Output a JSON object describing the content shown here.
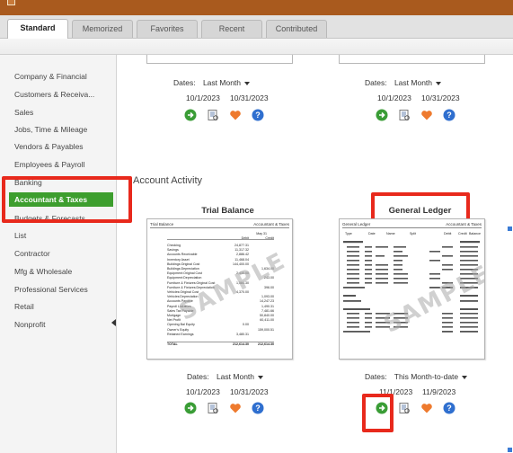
{
  "tabs": [
    {
      "label": "Standard",
      "active": true
    },
    {
      "label": "Memorized",
      "active": false
    },
    {
      "label": "Favorites",
      "active": false
    },
    {
      "label": "Recent",
      "active": false
    },
    {
      "label": "Contributed",
      "active": false
    }
  ],
  "sidebar": {
    "items": [
      {
        "label": "Company & Financial"
      },
      {
        "label": "Customers & Receiva..."
      },
      {
        "label": "Sales"
      },
      {
        "label": "Jobs, Time & Mileage"
      },
      {
        "label": "Vendors & Payables"
      },
      {
        "label": "Employees & Payroll"
      },
      {
        "label": "Banking"
      },
      {
        "label": "Accountant & Taxes",
        "active": true
      },
      {
        "label": "Budgets & Forecasts"
      },
      {
        "label": "List"
      },
      {
        "label": "Contractor"
      },
      {
        "label": "Mfg & Wholesale"
      },
      {
        "label": "Professional Services"
      },
      {
        "label": "Retail"
      },
      {
        "label": "Nonprofit"
      }
    ]
  },
  "top_cards": {
    "left": {
      "dates_label": "Dates:",
      "dates_value": "Last Month",
      "from": "10/1/2023",
      "to": "10/31/2023"
    },
    "right": {
      "dates_label": "Dates:",
      "dates_value": "Last Month",
      "from": "10/1/2023",
      "to": "10/31/2023"
    }
  },
  "section": {
    "title": "Account Activity"
  },
  "trial_balance": {
    "title": "Trial Balance",
    "header_left": "Trial Balance",
    "header_right": "Accountant & Taxes",
    "col_header_date": "May 31",
    "col_debit": "Debit",
    "col_credit": "Credit",
    "rows": [
      {
        "name": "Checking",
        "debit": "24,877.31",
        "credit": ""
      },
      {
        "name": "Savings",
        "debit": "11,317.32",
        "credit": ""
      },
      {
        "name": "Accounts Receivable",
        "debit": "2,886.42",
        "credit": ""
      },
      {
        "name": "Inventory Asset",
        "debit": "11,468.04",
        "credit": ""
      },
      {
        "name": "Buildings:Original Cost",
        "debit": "144,400.00",
        "credit": ""
      },
      {
        "name": "Buildings:Depreciation",
        "debit": "",
        "credit": "1,634.00"
      },
      {
        "name": "Equipment:Original Cost",
        "debit": "2,430.00",
        "credit": ""
      },
      {
        "name": "Equipment:Depreciation",
        "debit": "",
        "credit": "243.00"
      },
      {
        "name": "Furniture & Fixtures:Original Cost",
        "debit": "1,584.30",
        "credit": ""
      },
      {
        "name": "Furniture & Fixtures:Depreciation",
        "debit": "",
        "credit": "396.00"
      },
      {
        "name": "Vehicles:Original Cost",
        "debit": "4,370.00",
        "credit": ""
      },
      {
        "name": "Vehicles:Depreciation",
        "debit": "",
        "credit": "1,093.00"
      },
      {
        "name": "Accounts Payable",
        "debit": "",
        "credit": "14,247.23"
      },
      {
        "name": "Payroll Liabilities",
        "debit": "",
        "credit": "1,490.31"
      },
      {
        "name": "Sales Tax Payable",
        "debit": "",
        "credit": "7,481.66"
      },
      {
        "name": "Mortgage",
        "debit": "",
        "credit": "50,840.00"
      },
      {
        "name": "Net Profit",
        "debit": "",
        "credit": "60,411.00"
      },
      {
        "name": "Opening Bal Equity",
        "debit": "0.00",
        "credit": ""
      },
      {
        "name": "Owner's Equity",
        "debit": "",
        "credit": "159,000.51"
      },
      {
        "name": "Retained Earnings",
        "debit": "3,480.31",
        "credit": ""
      }
    ],
    "total_label": "TOTAL",
    "total_debit": "212,614.30",
    "total_credit": "212,614.30",
    "watermark": "SAMPLE",
    "dates_label": "Dates:",
    "dates_value": "Last Month",
    "from": "10/1/2023",
    "to": "10/31/2023"
  },
  "general_ledger": {
    "title": "General Ledger",
    "header_left": "General Ledger",
    "header_right": "Accountant & Taxes",
    "columns": [
      "Type",
      "Date",
      "Name",
      "Split",
      "Debit",
      "Credit",
      "Balance"
    ],
    "watermark": "SAMPLE",
    "dates_label": "Dates:",
    "dates_value": "This Month-to-date",
    "from": "11/1/2023",
    "to": "11/9/2023"
  },
  "colors": {
    "accent_green": "#3d9e2e",
    "highlight_red": "#e8291c",
    "titlebar": "#a95a1e"
  },
  "icons": [
    "run-report-icon",
    "info-icon",
    "favorite-heart-icon",
    "help-icon"
  ]
}
